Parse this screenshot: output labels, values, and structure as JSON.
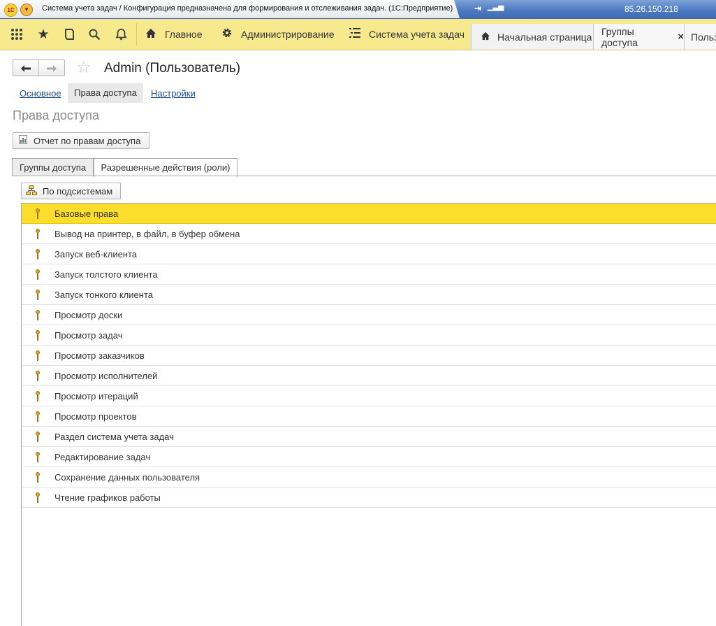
{
  "window": {
    "title": "Система учета задач / Конфигурация предназначена для формирования и отслеживания задач.  (1С:Предприятие)",
    "logo": "1С",
    "ip": "85.26.150.218"
  },
  "toolbar": {
    "icons": [
      "apps-grid-icon",
      "favorites-star-icon",
      "history-icon",
      "search-icon",
      "notifications-bell-icon"
    ],
    "nav": [
      {
        "label": "Главное",
        "icon": "home-icon"
      },
      {
        "label": "Администрирование",
        "icon": "gear-icon"
      },
      {
        "label": "Система учета задач",
        "icon": "list-icon"
      }
    ],
    "open_tabs": [
      {
        "label": "Начальная страница",
        "icon": "home-icon"
      },
      {
        "label": "Группы доступа",
        "close": "×"
      },
      {
        "label": "Польз"
      }
    ]
  },
  "form": {
    "title": "Admin (Пользователь)",
    "sections": [
      "Основное",
      "Права доступа",
      "Настройки"
    ],
    "page_title": "Права доступа",
    "report_button": "Отчет по правам доступа",
    "tabs": [
      "Группы доступа",
      "Разрешенные действия (роли)"
    ],
    "subsystems_button": "По подсистемам",
    "roles": [
      "Базовые права",
      "Вывод на принтер, в файл, в буфер обмена",
      "Запуск веб-клиента",
      "Запуск толстого клиента",
      "Запуск тонкого клиента",
      "Просмотр доски",
      "Просмотр задач",
      "Просмотр заказчиков",
      "Просмотр исполнителей",
      "Просмотр итераций",
      "Просмотр проектов",
      "Раздел система учета задач",
      "Редактирование задач",
      "Сохранение данных пользователя",
      "Чтение графиков работы"
    ]
  },
  "colors": {
    "toolbar": "#f7e98e",
    "selected_row": "#fbdd2c",
    "link": "#1c4b94"
  }
}
